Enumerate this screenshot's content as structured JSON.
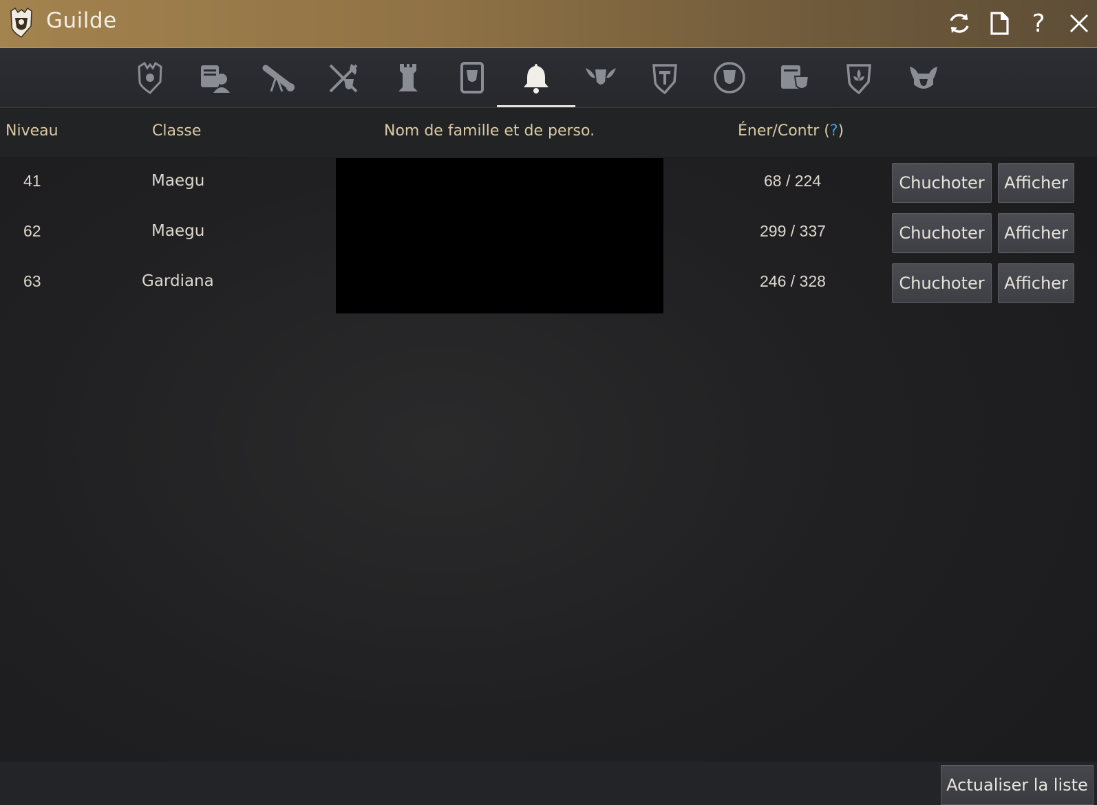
{
  "window": {
    "title": "Guilde"
  },
  "titlebar": {
    "icons": [
      "refresh-icon",
      "document-icon",
      "help-icon",
      "close-icon"
    ],
    "help_label": "?"
  },
  "tabs": [
    {
      "name": "guild-crest-tab",
      "active": false
    },
    {
      "name": "guild-members-tab",
      "active": false
    },
    {
      "name": "guild-scroll-tab",
      "active": false
    },
    {
      "name": "guild-war-tab",
      "active": false
    },
    {
      "name": "guild-tower-tab",
      "active": false
    },
    {
      "name": "guild-quest-tab",
      "active": false
    },
    {
      "name": "guild-notification-tab",
      "active": true
    },
    {
      "name": "guild-mercenary-tab",
      "active": false
    },
    {
      "name": "guild-shield-tab",
      "active": false
    },
    {
      "name": "guild-emblem-tab",
      "active": false
    },
    {
      "name": "guild-contract-tab",
      "active": false
    },
    {
      "name": "guild-fleur-tab",
      "active": false
    },
    {
      "name": "guild-mask-tab",
      "active": false
    }
  ],
  "table": {
    "headers": {
      "level": "Niveau",
      "class": "Classe",
      "name": "Nom de famille et de perso.",
      "energy_prefix": "Éner/Contr (",
      "energy_q": "?",
      "energy_suffix": ")"
    },
    "rows": [
      {
        "level": "41",
        "class": "Maegu",
        "energy": "68 / 224",
        "whisper": "Chuchoter",
        "view": "Afficher"
      },
      {
        "level": "62",
        "class": "Maegu",
        "energy": "299 / 337",
        "whisper": "Chuchoter",
        "view": "Afficher"
      },
      {
        "level": "63",
        "class": "Gardiana",
        "energy": "246 / 328",
        "whisper": "Chuchoter",
        "view": "Afficher"
      }
    ]
  },
  "footer": {
    "refresh_label": "Actualiser la liste"
  },
  "colors": {
    "title_bar": "#8f7245",
    "header_text": "#dcc9a4",
    "help_accent": "#35a8ea",
    "active_tab_underline": "#e7e3da"
  }
}
